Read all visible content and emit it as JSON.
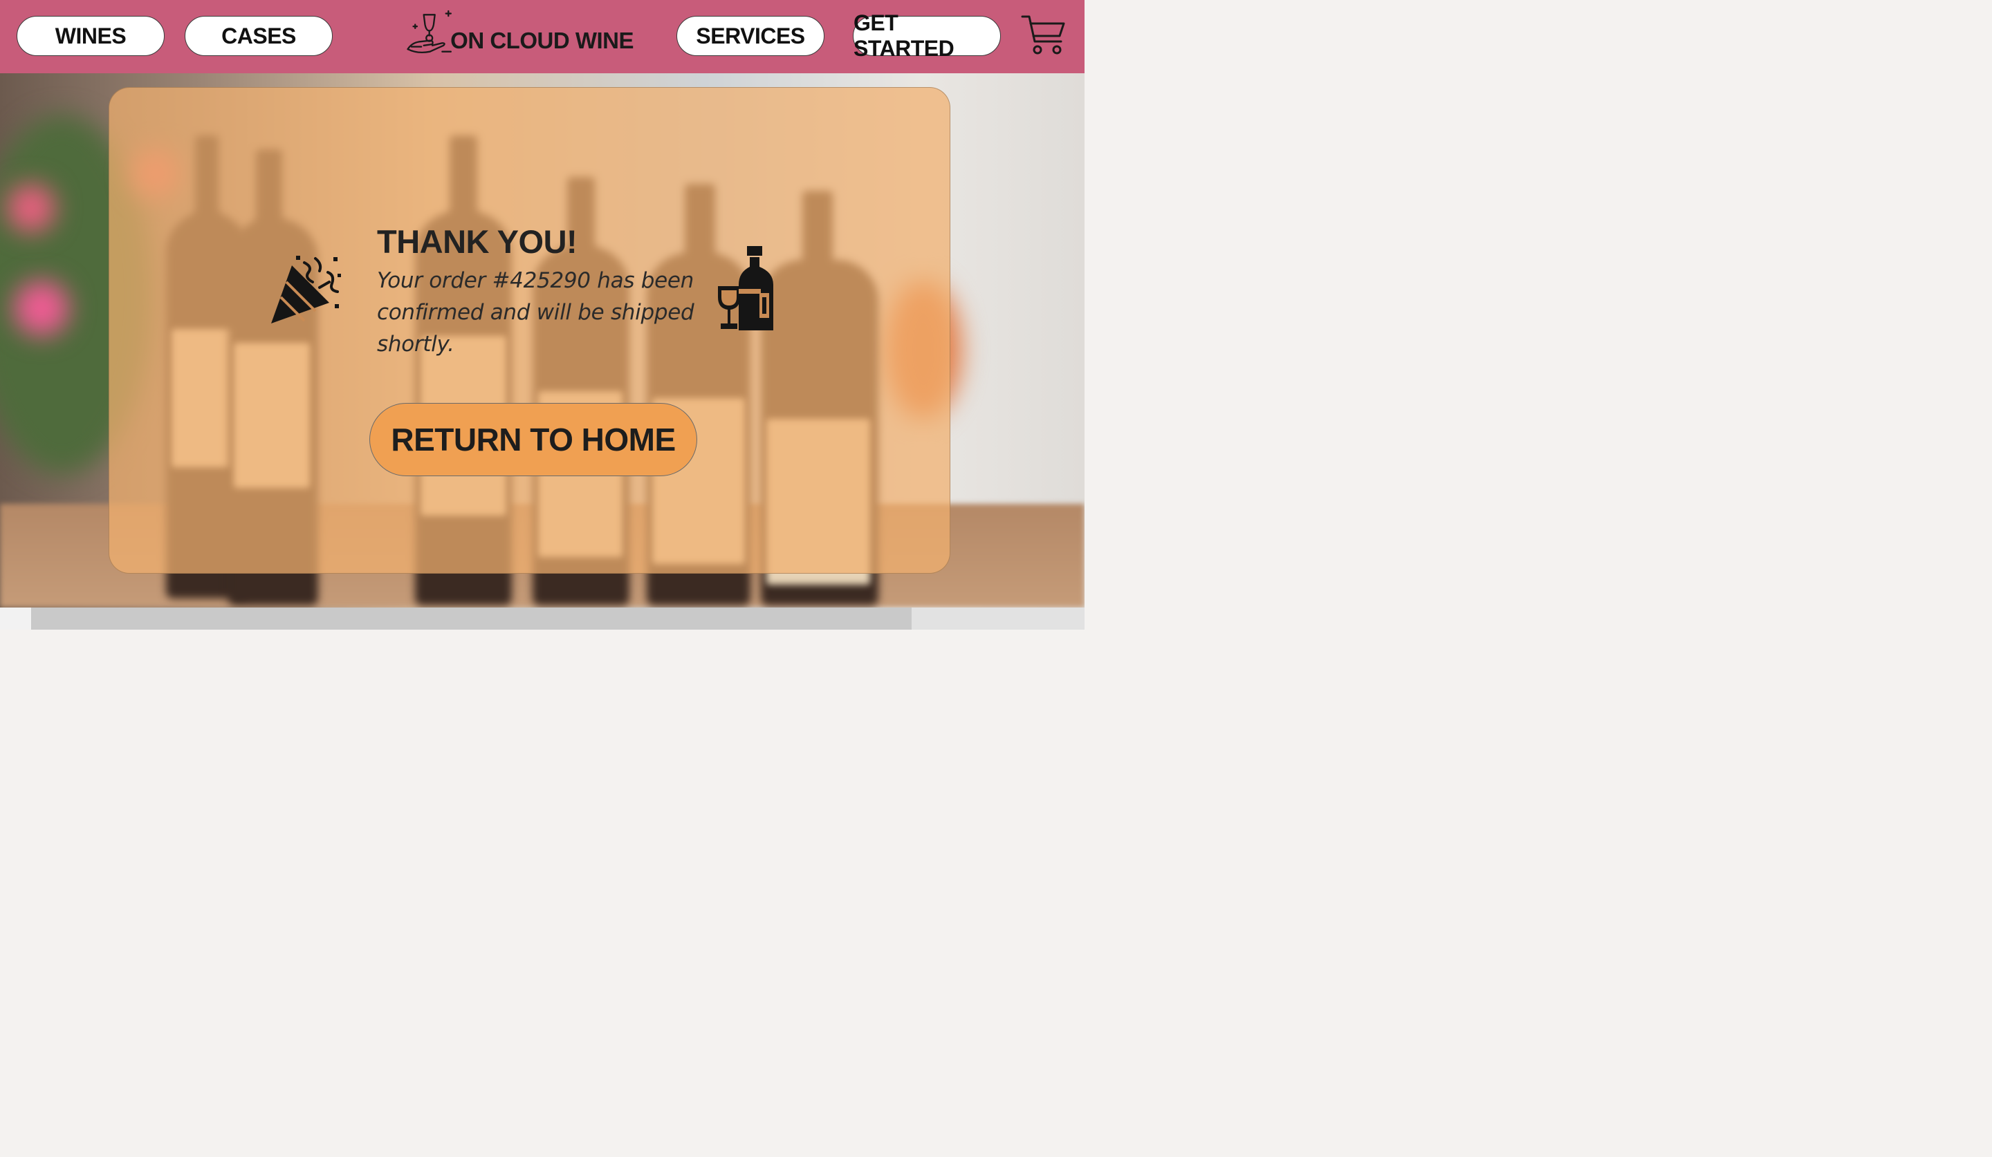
{
  "brand": {
    "name": "ON CLOUD WINE",
    "primary_color": "#c85c7a",
    "accent_color": "#f0a052"
  },
  "nav": {
    "wines": "WINES",
    "cases": "CASES",
    "services": "SERVICES",
    "get_started": "GET STARTED",
    "cart_icon": "shopping-cart-icon"
  },
  "confirmation": {
    "title": "THANK YOU!",
    "message": "Your order #425290 has been confirmed and will be shipped shortly.",
    "left_icon": "party-popper-icon",
    "right_icon": "wine-bottle-glass-icon",
    "button_label": "RETURN TO HOME"
  }
}
